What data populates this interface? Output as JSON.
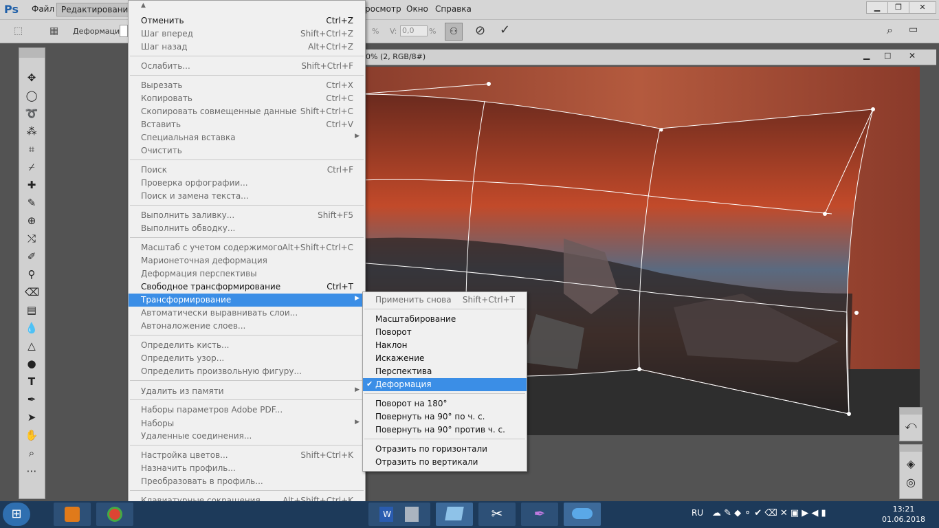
{
  "menubar": {
    "logo": "Ps",
    "file": "Файл",
    "edit": "Редактирование",
    "view": "росмотр",
    "window": "Окно",
    "help": "Справка"
  },
  "optbar": {
    "warp_label": "Деформация:",
    "v_label": "V:",
    "v_value": "0,0",
    "pct1": "%",
    "pct2": "%"
  },
  "document": {
    "title_fragment": "0% (2, RGB/8#)"
  },
  "edit_menu": {
    "up_arrow": "▲",
    "down_arrow": "▼",
    "items": [
      {
        "label": "Отменить",
        "shortcut": "Ctrl+Z"
      },
      {
        "label": "Шаг вперед",
        "shortcut": "Shift+Ctrl+Z"
      },
      {
        "label": "Шаг назад",
        "shortcut": "Alt+Ctrl+Z"
      },
      {
        "label": "Ослабить...",
        "shortcut": "Shift+Ctrl+F"
      },
      {
        "label": "Вырезать",
        "shortcut": "Ctrl+X"
      },
      {
        "label": "Копировать",
        "shortcut": "Ctrl+C"
      },
      {
        "label": "Скопировать совмещенные данные",
        "shortcut": "Shift+Ctrl+C"
      },
      {
        "label": "Вставить",
        "shortcut": "Ctrl+V"
      },
      {
        "label": "Специальная вставка",
        "shortcut": ""
      },
      {
        "label": "Очистить",
        "shortcut": ""
      },
      {
        "label": "Поиск",
        "shortcut": "Ctrl+F"
      },
      {
        "label": "Проверка орфографии...",
        "shortcut": ""
      },
      {
        "label": "Поиск и замена текста...",
        "shortcut": ""
      },
      {
        "label": "Выполнить заливку...",
        "shortcut": "Shift+F5"
      },
      {
        "label": "Выполнить обводку...",
        "shortcut": ""
      },
      {
        "label": "Масштаб с учетом содержимого",
        "shortcut": "Alt+Shift+Ctrl+C"
      },
      {
        "label": "Марионеточная деформация",
        "shortcut": ""
      },
      {
        "label": "Деформация перспективы",
        "shortcut": ""
      },
      {
        "label": "Свободное трансформирование",
        "shortcut": "Ctrl+T"
      },
      {
        "label": "Трансформирование",
        "shortcut": ""
      },
      {
        "label": "Автоматически выравнивать слои...",
        "shortcut": ""
      },
      {
        "label": "Автоналожение слоев...",
        "shortcut": ""
      },
      {
        "label": "Определить кисть...",
        "shortcut": ""
      },
      {
        "label": "Определить узор...",
        "shortcut": ""
      },
      {
        "label": "Определить произвольную фигуру...",
        "shortcut": ""
      },
      {
        "label": "Удалить из памяти",
        "shortcut": ""
      },
      {
        "label": "Наборы параметров Adobe PDF...",
        "shortcut": ""
      },
      {
        "label": "Наборы",
        "shortcut": ""
      },
      {
        "label": "Удаленные соединения...",
        "shortcut": ""
      },
      {
        "label": "Настройка цветов...",
        "shortcut": "Shift+Ctrl+K"
      },
      {
        "label": "Назначить профиль...",
        "shortcut": ""
      },
      {
        "label": "Преобразовать в профиль...",
        "shortcut": ""
      },
      {
        "label": "Клавиатурные сокращения...",
        "shortcut": "Alt+Shift+Ctrl+K"
      }
    ]
  },
  "transform_submenu": {
    "items": [
      {
        "label": "Применить снова",
        "shortcut": "Shift+Ctrl+T"
      },
      {
        "label": "Масштабирование",
        "shortcut": ""
      },
      {
        "label": "Поворот",
        "shortcut": ""
      },
      {
        "label": "Наклон",
        "shortcut": ""
      },
      {
        "label": "Искажение",
        "shortcut": ""
      },
      {
        "label": "Перспектива",
        "shortcut": ""
      },
      {
        "label": "Деформация",
        "shortcut": ""
      },
      {
        "label": "Поворот на 180°",
        "shortcut": ""
      },
      {
        "label": "Повернуть на 90° по ч. с.",
        "shortcut": ""
      },
      {
        "label": "Повернуть на 90° против ч. с.",
        "shortcut": ""
      },
      {
        "label": "Отразить по горизонтали",
        "shortcut": ""
      },
      {
        "label": "Отразить по вертикали",
        "shortcut": ""
      }
    ]
  },
  "taskbar": {
    "lang": "RU",
    "time": "13:21",
    "date": "01.06.2018"
  },
  "colors": {
    "highlight": "#3b8ee6",
    "taskbar": "#1d3a5a"
  }
}
